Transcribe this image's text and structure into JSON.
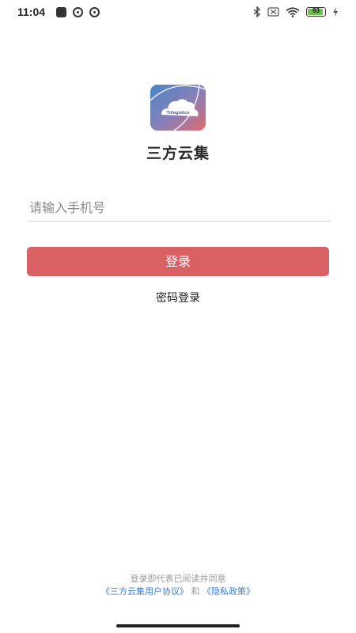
{
  "status_bar": {
    "time": "11:04",
    "battery_level": "93",
    "battery_fill_fraction": 0.93
  },
  "app": {
    "name": "三方云集",
    "logo_text": "Trilogistics"
  },
  "form": {
    "phone_placeholder": "请输入手机号",
    "login_label": "登录",
    "password_login_label": "密码登录"
  },
  "agreement": {
    "line1": "登录即代表已阅读并同意",
    "user_agreement": "《三方云集用户协议》",
    "conjunction": "和",
    "privacy_policy": "《隐私政策》"
  },
  "colors": {
    "accent": "#d96164",
    "link": "#3b7fd0"
  }
}
